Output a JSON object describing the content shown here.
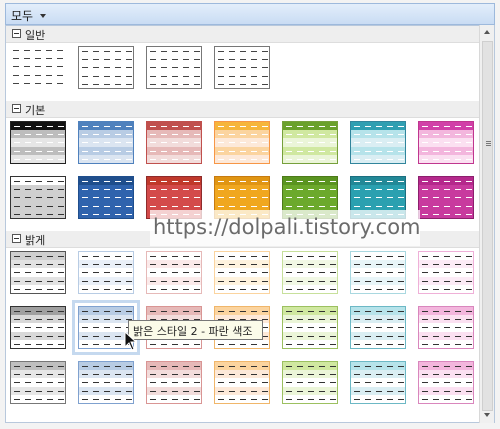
{
  "dropdown": {
    "label": "모두"
  },
  "sections": [
    {
      "title": "일반",
      "styles": [
        {
          "border": "none",
          "head": "#ffffff",
          "band": "#ffffff",
          "body": "#ffffff",
          "dash": "#444444"
        },
        {
          "border": "#777777",
          "head": "#ffffff",
          "band": "#ffffff",
          "body": "#ffffff",
          "dash": "#444444"
        },
        {
          "border": "#777777",
          "head": "#ffffff",
          "band": "#ffffff",
          "body": "#ffffff",
          "dash": "#444444"
        },
        {
          "border": "#777777",
          "head": "#ffffff",
          "band": "#ffffff",
          "body": "#ffffff",
          "dash": "#444444"
        }
      ]
    },
    {
      "title": "기본",
      "styles": [
        {
          "border": "#222222",
          "head": "#111111",
          "band": "#bdbdbd",
          "body": "#e6e6e6",
          "dash": "#ffffff"
        },
        {
          "border": "#4f81bd",
          "head": "#4f81bd",
          "band": "#b8cce4",
          "body": "#dbe5f1",
          "dash": "#ffffff"
        },
        {
          "border": "#c0504d",
          "head": "#c0504d",
          "band": "#e6b9b8",
          "body": "#f2dcdb",
          "dash": "#ffffff"
        },
        {
          "border": "#f79646",
          "head": "#f6b53b",
          "band": "#fbd49f",
          "body": "#fde9d9",
          "dash": "#ffffff"
        },
        {
          "border": "#76a03b",
          "head": "#6aa12b",
          "band": "#d0e8a0",
          "body": "#ebf5d8",
          "dash": "#ffffff"
        },
        {
          "border": "#31859c",
          "head": "#2f9fb2",
          "band": "#b6e3ea",
          "body": "#daeef3",
          "dash": "#ffffff"
        },
        {
          "border": "#c0368f",
          "head": "#d140a8",
          "band": "#f3b6dd",
          "body": "#fbe0f1",
          "dash": "#ffffff"
        }
      ]
    },
    {
      "title": "",
      "styles": [
        {
          "border": "#333333",
          "head": "#ffffff",
          "band": "#d0d0d0",
          "body": "#d0d0d0",
          "dash": "#333333"
        },
        {
          "border": "#1f4e8c",
          "head": "#1f4e8c",
          "band": "#2f63ad",
          "body": "#2f63ad",
          "dash": "#ffffff"
        },
        {
          "border": "#8e2b2b",
          "head": "#c0392b",
          "band": "#d34a4a",
          "body": "#d34a4a",
          "dash": "#ffffff"
        },
        {
          "border": "#c77b11",
          "head": "#e09513",
          "band": "#f0a71f",
          "body": "#f0a71f",
          "dash": "#ffffff"
        },
        {
          "border": "#4d7a1a",
          "head": "#5a9420",
          "band": "#6ca92c",
          "body": "#6ca92c",
          "dash": "#ffffff"
        },
        {
          "border": "#1c6f80",
          "head": "#228897",
          "band": "#2aa0b0",
          "body": "#2aa0b0",
          "dash": "#ffffff"
        },
        {
          "border": "#8c1f6d",
          "head": "#b5288c",
          "band": "#c83a9e",
          "body": "#c83a9e",
          "dash": "#ffffff"
        }
      ]
    },
    {
      "title": "밝게",
      "styles": [
        {
          "border": "#555555",
          "head": "#cfcfcf",
          "band": "#e2e2e2",
          "body": "#ffffff",
          "dash": "#333333"
        },
        {
          "border": "#b8cce4",
          "head": "#ffffff",
          "band": "#eaf0f8",
          "body": "#ffffff",
          "dash": "#333333"
        },
        {
          "border": "#e6b9b8",
          "head": "#ffffff",
          "band": "#fbeaea",
          "body": "#ffffff",
          "dash": "#333333"
        },
        {
          "border": "#fbd49f",
          "head": "#ffffff",
          "band": "#fff3de",
          "body": "#ffffff",
          "dash": "#333333"
        },
        {
          "border": "#c7e09b",
          "head": "#ffffff",
          "band": "#f1f8e4",
          "body": "#ffffff",
          "dash": "#333333"
        },
        {
          "border": "#a9d8e0",
          "head": "#ffffff",
          "band": "#e8f5f8",
          "body": "#ffffff",
          "dash": "#333333"
        },
        {
          "border": "#efb0d8",
          "head": "#ffffff",
          "band": "#fcebf6",
          "body": "#ffffff",
          "dash": "#333333"
        }
      ]
    },
    {
      "title": "",
      "styles": [
        {
          "border": "#333333",
          "head": "#9f9f9f",
          "band": "#d8d8d8",
          "body": "#ffffff",
          "dash": "#333333"
        },
        {
          "border": "#7fa1cf",
          "head": "#b8cce4",
          "band": "#dbe5f1",
          "body": "#ffffff",
          "dash": "#333333"
        },
        {
          "border": "#d99594",
          "head": "#e6b9b8",
          "band": "#f2dcdb",
          "body": "#ffffff",
          "dash": "#333333"
        },
        {
          "border": "#f0b66a",
          "head": "#fbd49f",
          "band": "#fde9d9",
          "body": "#ffffff",
          "dash": "#333333"
        },
        {
          "border": "#9cc060",
          "head": "#d0e8a0",
          "band": "#ebf5d8",
          "body": "#ffffff",
          "dash": "#333333"
        },
        {
          "border": "#6cb8c5",
          "head": "#b6e3ea",
          "band": "#daeef3",
          "body": "#ffffff",
          "dash": "#333333"
        },
        {
          "border": "#d986bd",
          "head": "#f3b6dd",
          "band": "#fbe0f1",
          "body": "#ffffff",
          "dash": "#333333"
        }
      ]
    },
    {
      "title": "",
      "styles": [
        {
          "border": "#777777",
          "head": "#bfbfbf",
          "band": "#e6e6e6",
          "body": "#ffffff",
          "dash": "#333333"
        },
        {
          "border": "#7fa1cf",
          "head": "#b8cce4",
          "band": "#dbe5f1",
          "body": "#ffffff",
          "dash": "#333333"
        },
        {
          "border": "#d99594",
          "head": "#e6b9b8",
          "band": "#f2dcdb",
          "body": "#ffffff",
          "dash": "#333333"
        },
        {
          "border": "#f0b66a",
          "head": "#fbd49f",
          "band": "#fde9d9",
          "body": "#ffffff",
          "dash": "#333333"
        },
        {
          "border": "#9cc060",
          "head": "#d0e8a0",
          "band": "#ebf5d8",
          "body": "#ffffff",
          "dash": "#333333"
        },
        {
          "border": "#6cb8c5",
          "head": "#b6e3ea",
          "band": "#daeef3",
          "body": "#ffffff",
          "dash": "#333333"
        },
        {
          "border": "#d986bd",
          "head": "#f3b6dd",
          "band": "#fbe0f1",
          "body": "#ffffff",
          "dash": "#333333"
        }
      ]
    }
  ],
  "tooltip": {
    "text": "밝은 스타일 2 - 파란 색조"
  },
  "watermark": {
    "text": "https://dolpali.tistory.com"
  },
  "hovered": {
    "section": 4,
    "index": 1
  }
}
